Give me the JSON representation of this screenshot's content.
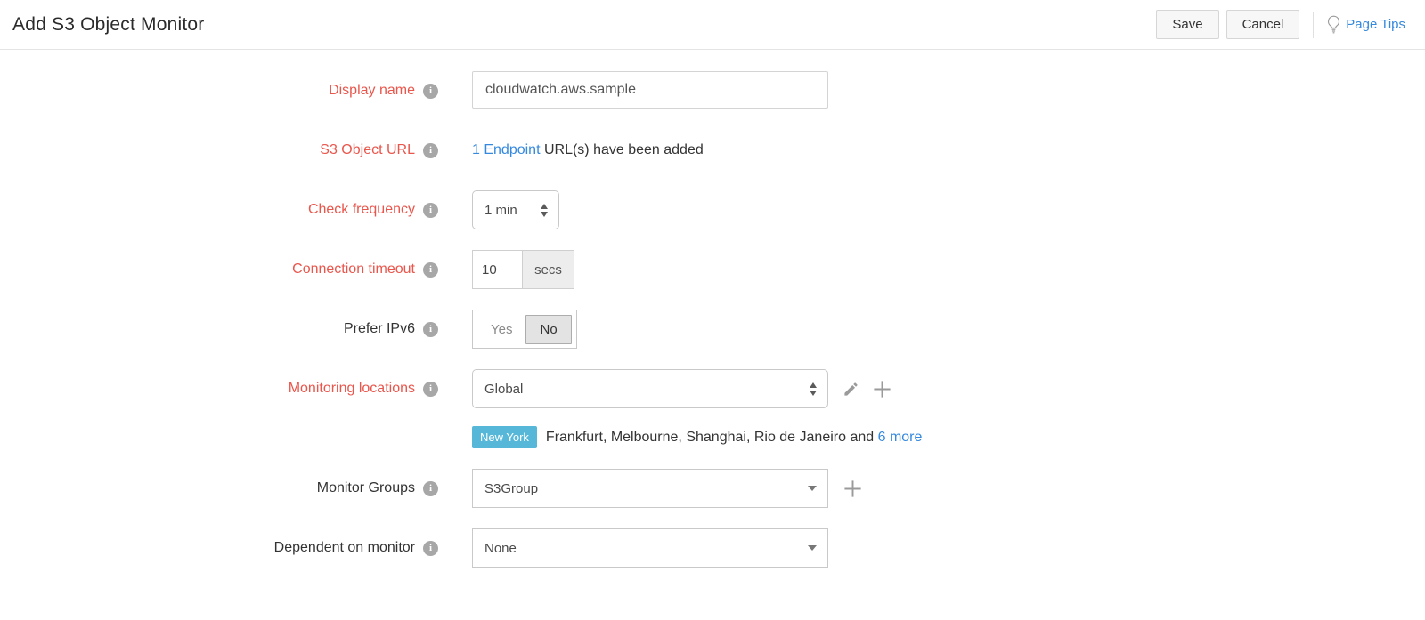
{
  "header": {
    "title": "Add S3 Object Monitor",
    "save_label": "Save",
    "cancel_label": "Cancel",
    "page_tips_label": "Page Tips"
  },
  "icons": {
    "info_icon": "i",
    "page_tips_icon": "lightbulb-outline",
    "edit_icon": "pencil",
    "add_icon": "plus",
    "frequency_select_arrows": "up-down-triangles",
    "dropdown_caret": "down-triangle"
  },
  "colors": {
    "required_label": "#e9564c",
    "link": "#3589de",
    "chip_bg": "#57b7d8",
    "selected_toggle_bg": "#e3e3e3"
  },
  "form": {
    "display_name": {
      "label": "Display name",
      "value": "cloudwatch.aws.sample"
    },
    "s3_object_url": {
      "label": "S3 Object URL",
      "link_text": "1 Endpoint",
      "rest_text": " URL(s) have been added"
    },
    "check_frequency": {
      "label": "Check frequency",
      "value": "1 min"
    },
    "connection_timeout": {
      "label": "Connection timeout",
      "value": "10",
      "unit": "secs"
    },
    "prefer_ipv6": {
      "label": "Prefer IPv6",
      "options": [
        "Yes",
        "No"
      ],
      "selected": "No"
    },
    "monitoring_locations": {
      "label": "Monitoring locations",
      "value": "Global",
      "chip": "New York",
      "others_text": "Frankfurt, Melbourne, Shanghai, Rio de Janeiro and",
      "more_link": "6 more"
    },
    "monitor_groups": {
      "label": "Monitor Groups",
      "value": "S3Group"
    },
    "dependent_on_monitor": {
      "label": "Dependent on monitor",
      "value": "None"
    }
  }
}
